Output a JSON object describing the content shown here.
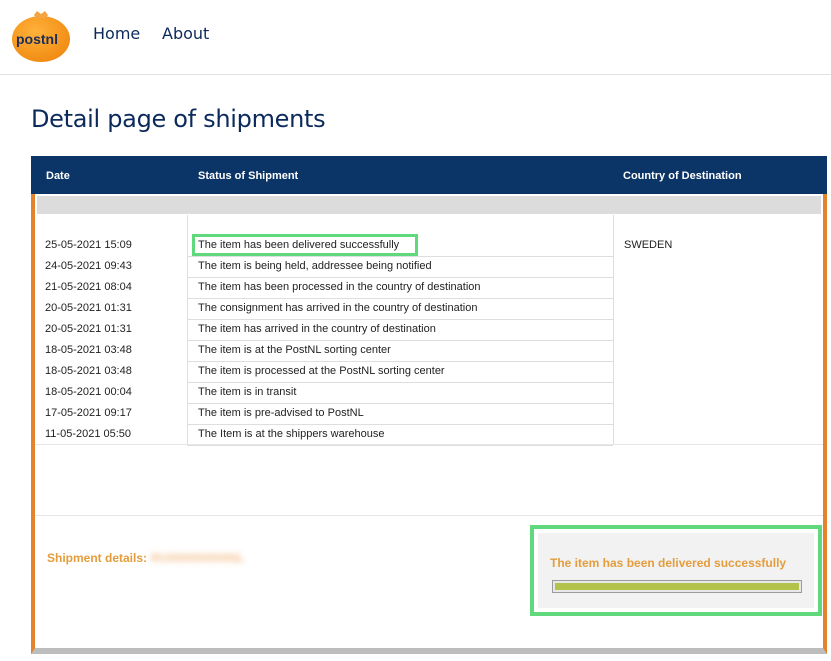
{
  "nav": {
    "logo_text": "postnl",
    "links": [
      {
        "label": "Home"
      },
      {
        "label": "About"
      }
    ]
  },
  "page": {
    "title": "Detail page of shipments"
  },
  "table": {
    "headers": {
      "date": "Date",
      "status": "Status of Shipment",
      "country": "Country of Destination"
    },
    "country_value": "SWEDEN",
    "rows": [
      {
        "date": "25-05-2021 15:09",
        "status": "The item has been delivered successfully"
      },
      {
        "date": "24-05-2021 09:43",
        "status": "The item is being held, addressee being notified"
      },
      {
        "date": "21-05-2021 08:04",
        "status": "The item has been processed in the country of destination"
      },
      {
        "date": "20-05-2021 01:31",
        "status": "The consignment has arrived in the country of destination"
      },
      {
        "date": "20-05-2021 01:31",
        "status": "The item has arrived in the country of destination"
      },
      {
        "date": "18-05-2021 03:48",
        "status": "The item is at the PostNL sorting center"
      },
      {
        "date": "18-05-2021 03:48",
        "status": "The item is processed at the PostNL sorting center"
      },
      {
        "date": "18-05-2021 00:04",
        "status": "The item is in transit"
      },
      {
        "date": "17-05-2021 09:17",
        "status": "The item is pre-advised to PostNL"
      },
      {
        "date": "11-05-2021 05:50",
        "status": "The Item is at the shippers warehouse"
      }
    ]
  },
  "shipment": {
    "details_label": "Shipment details:",
    "details_value": "RU000000000NL"
  },
  "delivery": {
    "status_text": "The item has been delivered successfully",
    "progress_fraction": 1.0
  },
  "colors": {
    "navy": "#0b3566",
    "orange": "#e3832b",
    "highlight_green": "#5fd97c",
    "progress_green": "#b3c24a"
  }
}
